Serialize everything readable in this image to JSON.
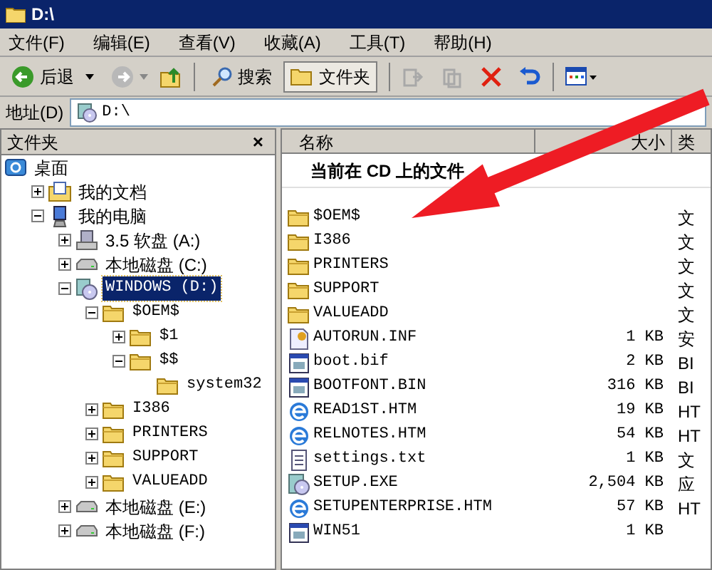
{
  "window": {
    "title": "D:\\"
  },
  "menu": [
    "文件(F)",
    "编辑(E)",
    "查看(V)",
    "收藏(A)",
    "工具(T)",
    "帮助(H)"
  ],
  "toolbar": {
    "back": "后退",
    "search": "搜索",
    "folders": {
      "label": "文件夹",
      "selected": true
    }
  },
  "address": {
    "label": "地址(D)",
    "value": "D:\\"
  },
  "folder_pane": {
    "title": "文件夹",
    "close": "×",
    "tree": [
      {
        "label": "桌面",
        "kind": "desktop",
        "selected": false,
        "children": [
          {
            "label": "我的文档",
            "kind": "docs",
            "expanded": false,
            "selected": false
          },
          {
            "label": "我的电脑",
            "kind": "computer",
            "expanded": true,
            "selected": false,
            "children": [
              {
                "label": "3.5 软盘 (A:)",
                "kind": "floppy",
                "expanded": false,
                "selected": false
              },
              {
                "label": "本地磁盘 (C:)",
                "kind": "drive",
                "expanded": false,
                "selected": false
              },
              {
                "label": "WINDOWS (D:)",
                "kind": "cd",
                "expanded": true,
                "selected": true,
                "children": [
                  {
                    "label": "$OEM$",
                    "kind": "folder",
                    "expanded": true,
                    "selected": false,
                    "children": [
                      {
                        "label": "$1",
                        "kind": "folder",
                        "expanded": false,
                        "selected": false
                      },
                      {
                        "label": "$$",
                        "kind": "folder",
                        "expanded": true,
                        "selected": false,
                        "children": [
                          {
                            "label": "system32",
                            "kind": "folder",
                            "selected": false
                          }
                        ]
                      }
                    ]
                  },
                  {
                    "label": "I386",
                    "kind": "folder",
                    "expanded": false,
                    "selected": false
                  },
                  {
                    "label": "PRINTERS",
                    "kind": "folder",
                    "expanded": false,
                    "selected": false
                  },
                  {
                    "label": "SUPPORT",
                    "kind": "folder",
                    "expanded": false,
                    "selected": false
                  },
                  {
                    "label": "VALUEADD",
                    "kind": "folder",
                    "expanded": false,
                    "selected": false
                  }
                ]
              },
              {
                "label": "本地磁盘 (E:)",
                "kind": "drive",
                "expanded": false,
                "selected": false
              },
              {
                "label": "本地磁盘 (F:)",
                "kind": "drive",
                "expanded": false,
                "selected": false
              }
            ]
          }
        ]
      }
    ]
  },
  "file_list": {
    "columns": [
      "名称",
      "大小",
      "类"
    ],
    "group": "当前在 CD 上的文件",
    "rows": [
      {
        "name": "$OEM$",
        "kind": "folder",
        "type": "文"
      },
      {
        "name": "I386",
        "kind": "folder",
        "type": "文"
      },
      {
        "name": "PRINTERS",
        "kind": "folder",
        "type": "文"
      },
      {
        "name": "SUPPORT",
        "kind": "folder",
        "type": "文"
      },
      {
        "name": "VALUEADD",
        "kind": "folder",
        "type": "文"
      },
      {
        "name": "AUTORUN.INF",
        "kind": "inf",
        "size": "1 KB",
        "type": "安"
      },
      {
        "name": "boot.bif",
        "kind": "bin",
        "size": "2 KB",
        "type": "BI"
      },
      {
        "name": "BOOTFONT.BIN",
        "kind": "bin",
        "size": "316 KB",
        "type": "BI"
      },
      {
        "name": "READ1ST.HTM",
        "kind": "htm",
        "size": "19 KB",
        "type": "HT"
      },
      {
        "name": "RELNOTES.HTM",
        "kind": "htm",
        "size": "54 KB",
        "type": "HT"
      },
      {
        "name": "settings.txt",
        "kind": "txt",
        "size": "1 KB",
        "type": "文"
      },
      {
        "name": "SETUP.EXE",
        "kind": "exe",
        "size": "2,504 KB",
        "type": "应"
      },
      {
        "name": "SETUPENTERPRISE.HTM",
        "kind": "htm",
        "size": "57 KB",
        "type": "HT"
      },
      {
        "name": "WIN51",
        "kind": "bin",
        "size": "1 KB"
      }
    ]
  }
}
